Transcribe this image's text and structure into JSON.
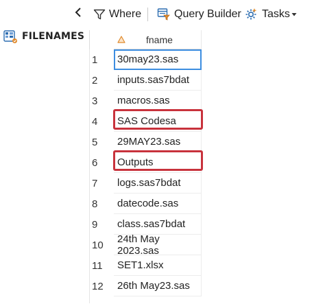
{
  "toolbar": {
    "where_label": "Where",
    "query_builder_label": "Query Builder",
    "tasks_label": "Tasks"
  },
  "dataset": {
    "name": "FILENAMES"
  },
  "table": {
    "column_header": "fname",
    "rows": [
      {
        "num": "1",
        "fname": "30may23.sas"
      },
      {
        "num": "2",
        "fname": "inputs.sas7bdat"
      },
      {
        "num": "3",
        "fname": "macros.sas"
      },
      {
        "num": "4",
        "fname": "SAS Codesa"
      },
      {
        "num": "5",
        "fname": "29MAY23.sas"
      },
      {
        "num": "6",
        "fname": "Outputs"
      },
      {
        "num": "7",
        "fname": "logs.sas7bdat"
      },
      {
        "num": "8",
        "fname": "datecode.sas"
      },
      {
        "num": "9",
        "fname": "class.sas7bdat"
      },
      {
        "num": "10",
        "fname": "24th May 2023.sas"
      },
      {
        "num": "11",
        "fname": "SET1.xlsx"
      },
      {
        "num": "12",
        "fname": "26th May23.sas"
      }
    ]
  },
  "colors": {
    "highlight": "#c8323c",
    "selection": "#3c8de0",
    "icon_blue": "#2b6cb0",
    "header_icon": "#e08a2c"
  },
  "icons": {
    "collapse": "chevron-left-icon",
    "where": "filter-funnel-icon",
    "query_builder": "query-builder-icon",
    "tasks": "tasks-gear-icon",
    "dataset": "dataset-table-icon",
    "column_type": "character-column-icon"
  }
}
